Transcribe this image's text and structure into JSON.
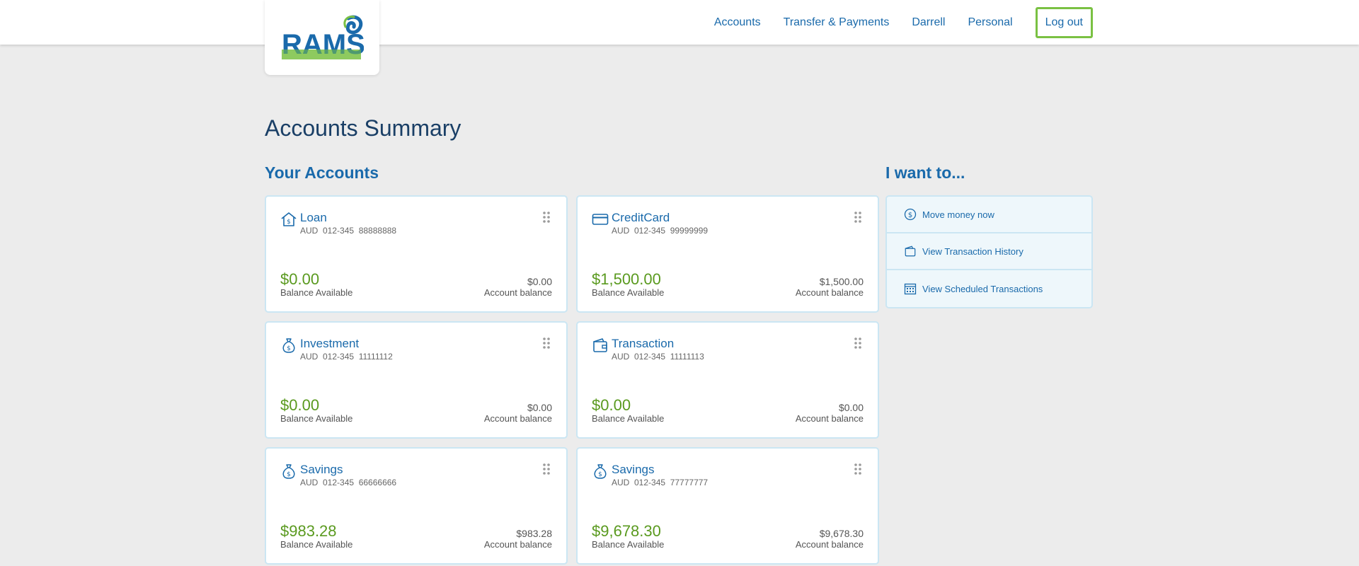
{
  "brand": {
    "logo_text": "RAMS"
  },
  "nav": {
    "items": [
      "Accounts",
      "Transfer & Payments",
      "Darrell",
      "Personal"
    ],
    "logout": "Log out"
  },
  "page_title": "Accounts Summary",
  "your_accounts_title": "Your Accounts",
  "i_want_to_title": "I want to...",
  "accounts": [
    {
      "name": "Loan",
      "icon": "house-dollar-icon",
      "account_line": "AUD  012-345  88888888",
      "available": "$0.00",
      "available_label": "Balance Available",
      "balance": "$0.00",
      "balance_label": "Account balance"
    },
    {
      "name": "CreditCard",
      "icon": "credit-card-icon",
      "account_line": "AUD  012-345  99999999",
      "available": "$1,500.00",
      "available_label": "Balance Available",
      "balance": "$1,500.00",
      "balance_label": "Account balance"
    },
    {
      "name": "Investment",
      "icon": "money-bag-icon",
      "account_line": "AUD  012-345  11111112",
      "available": "$0.00",
      "available_label": "Balance Available",
      "balance": "$0.00",
      "balance_label": "Account balance"
    },
    {
      "name": "Transaction",
      "icon": "wallet-icon",
      "account_line": "AUD  012-345  11111113",
      "available": "$0.00",
      "available_label": "Balance Available",
      "balance": "$0.00",
      "balance_label": "Account balance"
    },
    {
      "name": "Savings",
      "icon": "money-bag-icon",
      "account_line": "AUD  012-345  66666666",
      "available": "$983.28",
      "available_label": "Balance Available",
      "balance": "$983.28",
      "balance_label": "Account balance"
    },
    {
      "name": "Savings",
      "icon": "money-bag-icon",
      "account_line": "AUD  012-345  77777777",
      "available": "$9,678.30",
      "available_label": "Balance Available",
      "balance": "$9,678.30",
      "balance_label": "Account balance"
    }
  ],
  "actions": [
    {
      "label": "Move money now",
      "icon": "dollar-circle-icon"
    },
    {
      "label": "View Transaction History",
      "icon": "wallet-icon"
    },
    {
      "label": "View Scheduled Transactions",
      "icon": "calendar-icon"
    }
  ],
  "colors": {
    "brand_blue": "#1a6aab",
    "title_navy": "#1a3f66",
    "balance_green": "#5a9a1f",
    "logout_border": "#7ac143",
    "card_border": "#cbe6f3",
    "page_bg": "#ececec"
  }
}
